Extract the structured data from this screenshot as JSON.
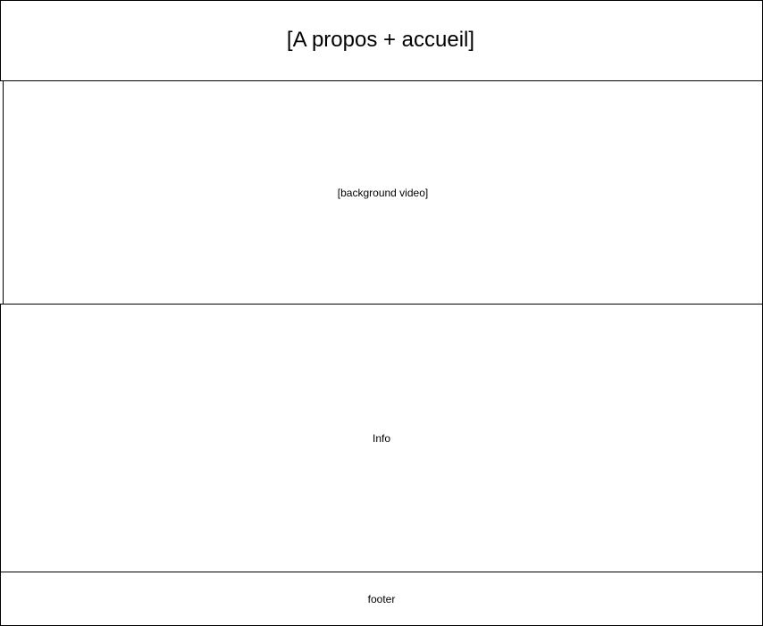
{
  "header": {
    "label": "[A propos + accueil]"
  },
  "video": {
    "label": "[background video]"
  },
  "info": {
    "label": "Info"
  },
  "footer": {
    "label": "footer"
  }
}
